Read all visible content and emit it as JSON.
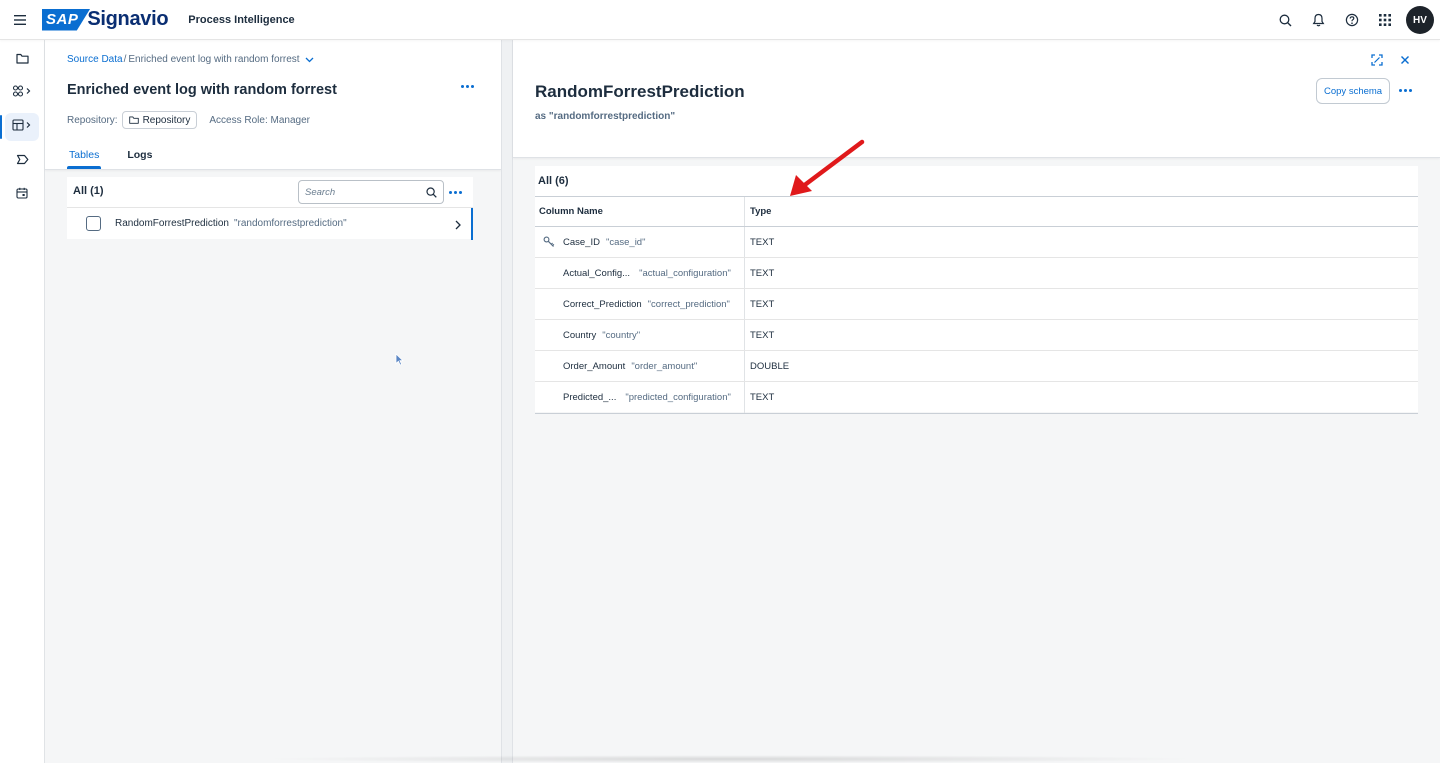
{
  "header": {
    "sap_logo": "SAP",
    "brand": "Signavio",
    "product": "Process Intelligence",
    "avatar_initials": "HV",
    "icons": [
      "menu-icon",
      "search-icon",
      "bell-icon",
      "help-icon",
      "apps-grid-icon"
    ]
  },
  "rail": {
    "items": [
      "folder-icon",
      "widgets-icon",
      "data-table-icon",
      "tag-icon",
      "calendar-icon"
    ],
    "active_index": 2
  },
  "left": {
    "breadcrumb": {
      "link": "Source Data",
      "separator": "/",
      "current": "Enriched event log with random forrest"
    },
    "title": "Enriched event log with random forrest",
    "repository_label": "Repository:",
    "repository_value": "Repository",
    "access_role": "Access Role: Manager",
    "tabs": [
      {
        "label": "Tables",
        "active": true
      },
      {
        "label": "Logs",
        "active": false
      }
    ],
    "all_count": "All (1)",
    "search_placeholder": "Search",
    "rows": [
      {
        "name": "RandomForrestPrediction",
        "alias": "\"randomforrestprediction\""
      }
    ]
  },
  "right": {
    "title": "RandomForrestPrediction",
    "subtitle": "as \"randomforrestprediction\"",
    "copy_button": "Copy schema",
    "all_count": "All (6)",
    "columns_header": {
      "name": "Column Name",
      "type": "Type"
    },
    "columns": [
      {
        "name": "Case_ID",
        "alias": "\"case_id\"",
        "type": "TEXT",
        "key": true
      },
      {
        "name": "Actual_Config...",
        "alias": "\"actual_configuration\"",
        "type": "TEXT",
        "key": false
      },
      {
        "name": "Correct_Prediction",
        "alias": "\"correct_prediction\"",
        "type": "TEXT",
        "key": false
      },
      {
        "name": "Country",
        "alias": "\"country\"",
        "type": "TEXT",
        "key": false
      },
      {
        "name": "Order_Amount",
        "alias": "\"order_amount\"",
        "type": "DOUBLE",
        "key": false
      },
      {
        "name": "Predicted_...",
        "alias": "\"predicted_configuration\"",
        "type": "TEXT",
        "key": false
      }
    ]
  },
  "colors": {
    "accent": "#0a6ed1",
    "brand_dark": "#0a2e72",
    "text": "#1d2d3e",
    "muted": "#556b82",
    "annotation_arrow": "#e0191b"
  }
}
